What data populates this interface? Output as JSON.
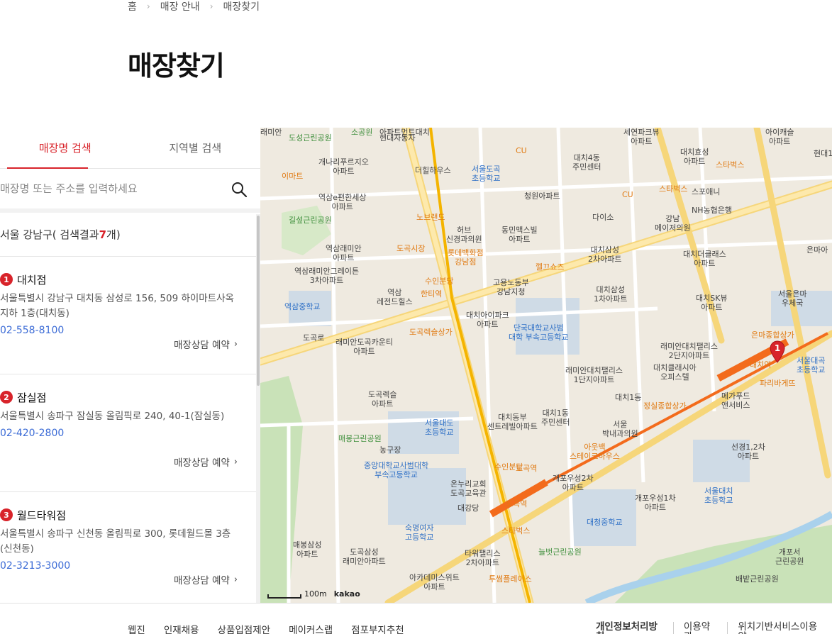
{
  "breadcrumb": [
    "홈",
    "매장 안내",
    "매장찾기"
  ],
  "page_title": "매장찾기",
  "tabs": [
    {
      "label": "매장명 검색",
      "active": true
    },
    {
      "label": "지역별 검색",
      "active": false
    }
  ],
  "search": {
    "placeholder": "매장명 또는 주소를 입력하세요",
    "value": "",
    "icon": "search-icon"
  },
  "results": {
    "region": "서울 강남구",
    "prefix": " ( 검색결과 ",
    "count": "7",
    "suffix": "개)"
  },
  "stores": [
    {
      "num": "1",
      "name": "대치점",
      "address": "서울특별시 강남구 대치동 삼성로 156, 509 하이마트사옥 지하 1층(대치동)",
      "tel": "02-558-8100",
      "reserve": "매장상담 예약"
    },
    {
      "num": "2",
      "name": "잠실점",
      "address": "서울특별시 송파구 잠실동 올림픽로 240, 40-1(잠실동)",
      "tel": "02-420-2800",
      "reserve": "매장상담 예약"
    },
    {
      "num": "3",
      "name": "월드타워점",
      "address": "서울특별시 송파구 신천동 올림픽로 300, 롯데월드몰 3층 (신천동)",
      "tel": "02-3213-3000",
      "reserve": "매장상담 예약"
    }
  ],
  "map": {
    "scale": "100m",
    "brand": "kakao",
    "marker": "1",
    "labels": [
      {
        "t": "도성근린공원",
        "c": "green"
      },
      {
        "t": "개나리푸르지오\n아파트",
        "c": ""
      },
      {
        "t": "현대자동차",
        "c": ""
      },
      {
        "t": "더힐하우스",
        "c": ""
      },
      {
        "t": "서울도곡\n초등학교",
        "c": "blue"
      },
      {
        "t": "CU",
        "c": "orange"
      },
      {
        "t": "대치4동\n주민센터",
        "c": ""
      },
      {
        "t": "대치효성\n아파트",
        "c": ""
      },
      {
        "t": "스타벅스",
        "c": "orange"
      },
      {
        "t": "이마트",
        "c": "orange"
      },
      {
        "t": "역삼e편한세상\n아파트",
        "c": ""
      },
      {
        "t": "청원아파트",
        "c": ""
      },
      {
        "t": "CU",
        "c": "orange"
      },
      {
        "t": "스타벅스",
        "c": "orange"
      },
      {
        "t": "스포애니",
        "c": ""
      },
      {
        "t": "NH농협은행",
        "c": ""
      },
      {
        "t": "길섶근린공원",
        "c": "green"
      },
      {
        "t": "노브랜드",
        "c": "orange"
      },
      {
        "t": "허브\n신경과의원",
        "c": ""
      },
      {
        "t": "동민맥스빌\n아파트",
        "c": ""
      },
      {
        "t": "다이소",
        "c": ""
      },
      {
        "t": "강남\n메이저의원",
        "c": ""
      },
      {
        "t": "역삼래미안\n아파트",
        "c": ""
      },
      {
        "t": "도곡시장",
        "c": "orange"
      },
      {
        "t": "롯데백화점\n강남점",
        "c": "orange"
      },
      {
        "t": "대치삼성\n2차아파트",
        "c": ""
      },
      {
        "t": "대치더클래스\n아파트",
        "c": ""
      },
      {
        "t": "역삼래미안그레이튼\n3차아파트",
        "c": ""
      },
      {
        "t": "껠끄쇼즈",
        "c": "orange"
      },
      {
        "t": "고용노동부\n강남지청",
        "c": ""
      },
      {
        "t": "수인분당",
        "c": "orange"
      },
      {
        "t": "한티역",
        "c": "orange"
      },
      {
        "t": "대치삼성\n1차아파트",
        "c": ""
      },
      {
        "t": "역삼\n레전드힐스",
        "c": ""
      },
      {
        "t": "역삼중학교",
        "c": "blue"
      },
      {
        "t": "대치SK뷰\n아파트",
        "c": ""
      },
      {
        "t": "서울은마\n우체국",
        "c": ""
      },
      {
        "t": "대치아이파크\n아파트",
        "c": ""
      },
      {
        "t": "단국대학교사범\n대학 부속고등학교",
        "c": "blue"
      },
      {
        "t": "도곡로",
        "c": ""
      },
      {
        "t": "래미안도곡카운티\n아파트",
        "c": ""
      },
      {
        "t": "도곡렉슬상가",
        "c": "orange"
      },
      {
        "t": "래미안대치팰리스\n2단지아파트",
        "c": ""
      },
      {
        "t": "은마종합상가",
        "c": "orange"
      },
      {
        "t": "대치역",
        "c": "orange"
      },
      {
        "t": "서울대곡\n초등학교",
        "c": "blue"
      },
      {
        "t": "대치클래시아\n오피스텔",
        "c": ""
      },
      {
        "t": "래미안대치팰리스\n1단지아파트",
        "c": ""
      },
      {
        "t": "파리바게뜨",
        "c": "orange"
      },
      {
        "t": "메가푸드\n앤서비스",
        "c": ""
      },
      {
        "t": "도곡렉슬\n아파트",
        "c": ""
      },
      {
        "t": "대치1동",
        "c": ""
      },
      {
        "t": "정실종합상가",
        "c": "orange"
      },
      {
        "t": "대치동부\n센트레빌아파트",
        "c": ""
      },
      {
        "t": "대치1동\n주민센터",
        "c": ""
      },
      {
        "t": "서울\n박내과의원",
        "c": ""
      },
      {
        "t": "서울대도\n초등학교",
        "c": "blue"
      },
      {
        "t": "매봉근린공원",
        "c": "green"
      },
      {
        "t": "농구장",
        "c": ""
      },
      {
        "t": "선경1,2차\n아파트",
        "c": ""
      },
      {
        "t": "아웃백\n스테이크하우스",
        "c": "orange"
      },
      {
        "t": "중앙대학교사범대학\n부속고등학교",
        "c": "blue"
      },
      {
        "t": "수인분당",
        "c": "orange"
      },
      {
        "t": "도곡역",
        "c": "orange"
      },
      {
        "t": "개포우성2차\n아파트",
        "c": ""
      },
      {
        "t": "온누리교회\n도곡교육관",
        "c": ""
      },
      {
        "t": "개포우성1차\n아파트",
        "c": ""
      },
      {
        "t": "서울대치\n초등학교",
        "c": "blue"
      },
      {
        "t": "대강당",
        "c": ""
      },
      {
        "t": "도곡역",
        "c": "orange"
      },
      {
        "t": "숙명여자\n고등학교",
        "c": "blue"
      },
      {
        "t": "대청중학교",
        "c": "blue"
      },
      {
        "t": "스타벅스",
        "c": "orange"
      },
      {
        "t": "늘벗근린공원",
        "c": "green"
      },
      {
        "t": "매봉삼성\n아파트",
        "c": ""
      },
      {
        "t": "도곡삼성\n래미안아파트",
        "c": ""
      },
      {
        "t": "타워팰리스\n2차아파트",
        "c": ""
      },
      {
        "t": "개포서\n근린공원",
        "c": ""
      },
      {
        "t": "아카데미스위트\n아파트",
        "c": ""
      },
      {
        "t": "투썸플레이스",
        "c": "orange"
      },
      {
        "t": "배밭근린공원",
        "c": ""
      },
      {
        "t": "은마아",
        "c": ""
      },
      {
        "t": "현대1",
        "c": ""
      },
      {
        "t": "세연파크뷰\n아파트",
        "c": ""
      },
      {
        "t": "아이캐슬\n아파트",
        "c": ""
      },
      {
        "t": "아파트먼트대치",
        "c": ""
      },
      {
        "t": "소공원",
        "c": "green"
      },
      {
        "t": "래미안",
        "c": ""
      }
    ]
  },
  "footer": {
    "left": [
      "웹진",
      "인재채용",
      "상품입점제안",
      "메이커스랩",
      "점포부지추천"
    ],
    "right": [
      "개인정보처리방침",
      "이용약관",
      "위치기반서비스이용약"
    ]
  }
}
